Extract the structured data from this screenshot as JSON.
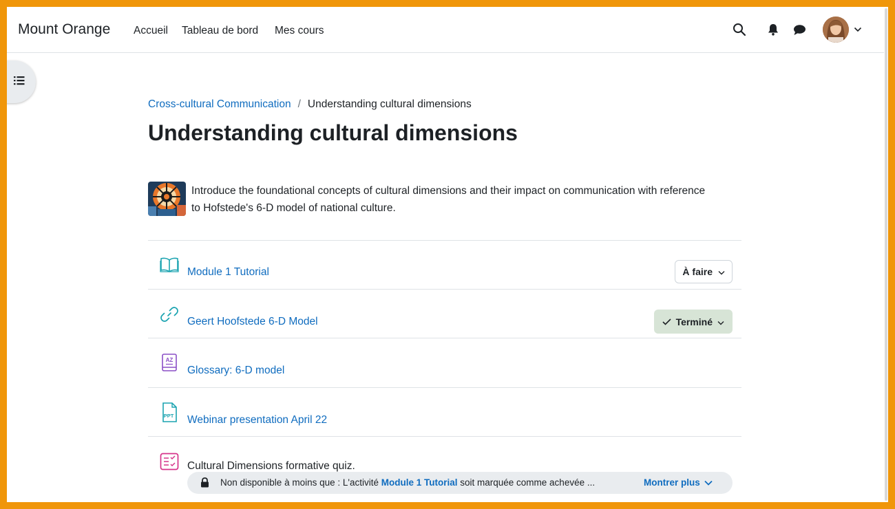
{
  "colors": {
    "frame_border": "#f0960a",
    "link": "#0f6cbf",
    "text": "#1d2125",
    "done_bg": "#d7e4d6",
    "restriction_bg": "#e9ecef"
  },
  "navbar": {
    "brand": "Mount Orange",
    "links": [
      "Accueil",
      "Tableau de bord",
      "Mes cours"
    ],
    "icons": [
      "search-icon",
      "bell-icon",
      "chat-icon",
      "avatar",
      "chevron-down-icon"
    ]
  },
  "drawer": {
    "icon": "list-icon"
  },
  "breadcrumb": {
    "course": "Cross-cultural Communication",
    "separator": "/",
    "current": "Understanding cultural dimensions"
  },
  "page_title": "Understanding cultural dimensions",
  "intro": {
    "text": "Introduce the foundational concepts of cultural dimensions and their impact on communication with reference to Hofstede's 6-D model of national culture."
  },
  "activities": [
    {
      "name": "Module 1 Tutorial",
      "icon": "book-icon",
      "status": "À faire"
    },
    {
      "name": "Geert Hoofstede 6-D Model",
      "icon": "link-icon",
      "status": "Terminé"
    },
    {
      "name": "Glossary: 6-D model",
      "icon": "glossary-icon",
      "status": ""
    },
    {
      "name": "Webinar presentation April 22",
      "icon": "ppt-file-icon",
      "status": ""
    },
    {
      "name": "Cultural Dimensions formative quiz.",
      "icon": "quiz-icon",
      "status": ""
    }
  ],
  "restriction": {
    "prefix": "Non disponible à moins que : L'activité",
    "activity": "Module 1 Tutorial",
    "suffix": "soit marquée comme achevée ...",
    "show_more": "Montrer plus"
  }
}
